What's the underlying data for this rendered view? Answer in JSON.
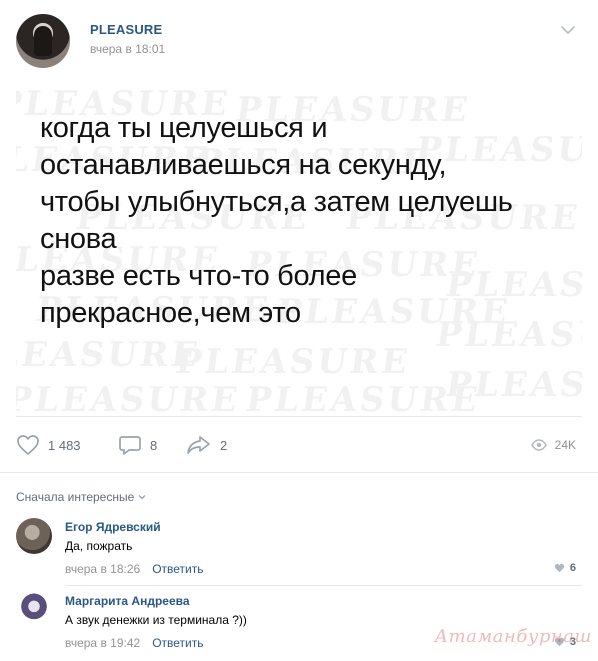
{
  "post": {
    "group_name": "PLEASURE",
    "time": "вчера в 18:01",
    "text_lines": [
      "когда ты целуешься и",
      "останавливаешься на секунду,",
      "чтобы улыбнуться,а затем целуешь",
      "снова",
      "разве есть что-то более",
      "прекрасное,чем это"
    ],
    "watermark_text": "PLEASURE"
  },
  "actions": {
    "likes": "1 483",
    "comments": "8",
    "shares": "2",
    "views": "24K"
  },
  "comments_section": {
    "sort_label": "Сначала интересные",
    "comments": [
      {
        "author": "Егор Ядревский",
        "text": "Да, пожрать",
        "time": "вчера в 18:26",
        "reply_label": "Ответить",
        "likes": "6"
      },
      {
        "author": "Маргарита Андреева",
        "text": "А звук денежки из терминала ?))",
        "time": "вчера в 19:42",
        "reply_label": "Ответить",
        "likes": "3"
      }
    ]
  },
  "site_watermark": "Атаманбурнаш",
  "colors": {
    "link": "#2a5885",
    "meta": "#939393",
    "icon": "#99a2ad",
    "divider": "#e7e8ec"
  },
  "icons": [
    "chevron-down-icon",
    "heart-icon",
    "comment-icon",
    "share-icon",
    "eye-icon"
  ]
}
